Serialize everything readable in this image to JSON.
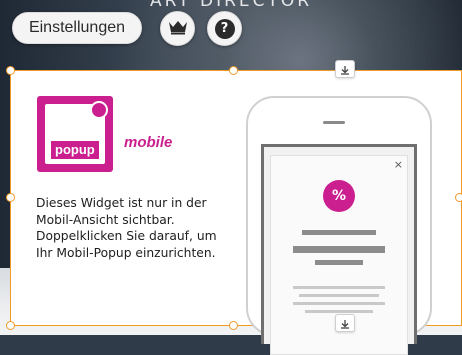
{
  "background": {
    "heading_text": "ART DIRECTOR"
  },
  "toolbar": {
    "settings_label": "Einstellungen",
    "crown_icon": "crown-icon",
    "help_icon": "help-icon",
    "help_glyph": "?"
  },
  "widget": {
    "logo_word": "popup",
    "logo_subword": "mobile",
    "description": "Dieses Widget ist nur in der Mobil-Ansicht sichtbar. Doppelklicken Sie darauf, um Ihr Mobil-Popup einzurichten.",
    "phone": {
      "close_glyph": "×",
      "badge_glyph": "%"
    }
  },
  "colors": {
    "accent": "#cc1f8f",
    "selection_border": "#f09a2a"
  }
}
